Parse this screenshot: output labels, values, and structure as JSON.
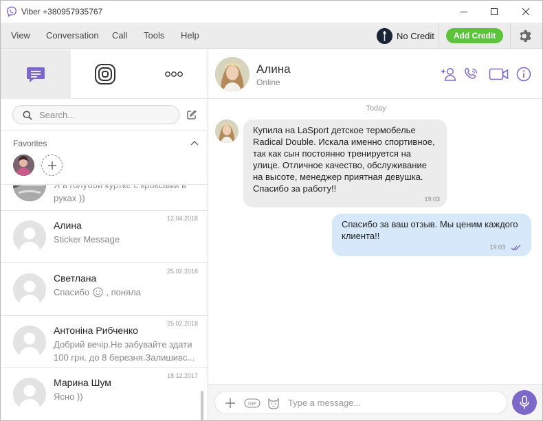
{
  "window": {
    "title": "Viber +380957935767"
  },
  "menu": {
    "items": [
      "View",
      "Conversation",
      "Call",
      "Tools",
      "Help"
    ],
    "credit_label": "No Credit",
    "add_credit_label": "Add Credit"
  },
  "sidebar": {
    "search_placeholder": "Search...",
    "favorites_label": "Favorites",
    "chats": [
      {
        "name": "",
        "date": "",
        "message": "Я в голубой куртке с кроксами в руках ))"
      },
      {
        "name": "Алина",
        "date": "12.04.2018",
        "message": "Sticker Message"
      },
      {
        "name": "Светлана",
        "date": "25.02.2018",
        "message": "Спасибо",
        "message_after_emoji": ", поняла"
      },
      {
        "name": "Антоніна Рибченко",
        "date": "25.02.2018",
        "message": "Добрий вечір.Не забувайте здати 100 грн. до 8 березня.Залишивс..."
      },
      {
        "name": "Марина Шум",
        "date": "18.12.2017",
        "message": "Ясно ))"
      }
    ]
  },
  "conversation": {
    "contact_name": "Алина",
    "contact_status": "Online",
    "day_label": "Today",
    "messages": [
      {
        "direction": "incoming",
        "text": "Купила на LaSport детское термобелье Radical Double. Искала именно спортивное, так как сын постоянно тренируется на улице. Отличное качество, обслуживание на высоте, менеджер приятная девушка. Спасибо за работу!!",
        "time": "19:03"
      },
      {
        "direction": "outgoing",
        "text": "Спасибо за ваш отзыв. Мы ценим каждого клиента!!",
        "time": "19:03"
      }
    ],
    "composer_placeholder": "Type a message..."
  },
  "colors": {
    "accent": "#7b68c8",
    "add_credit": "#5ec33c",
    "outgoing_bubble": "#d6e8fa",
    "incoming_bubble": "#ececec"
  }
}
